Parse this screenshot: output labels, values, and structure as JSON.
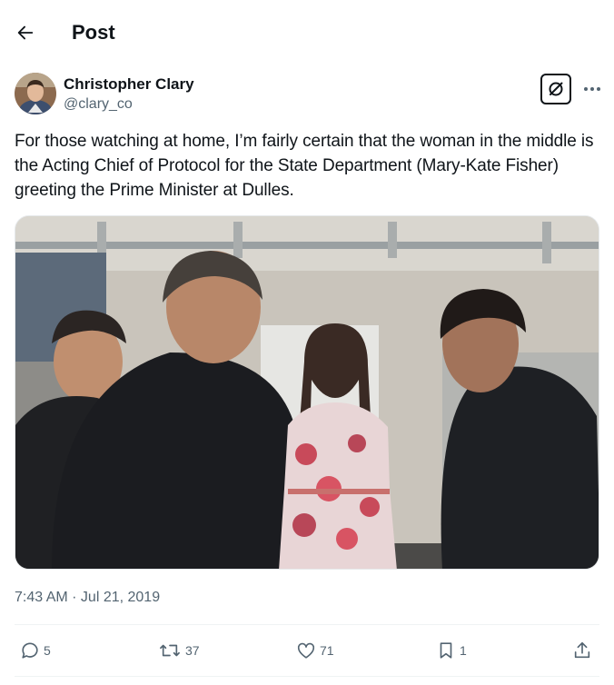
{
  "header": {
    "back_icon": "arrow-left-icon",
    "title": "Post"
  },
  "post": {
    "author_name": "Christopher Clary",
    "author_handle": "@clary_co",
    "grok_icon": "grok-icon",
    "more_icon": "more-horizontal-icon",
    "text": "For those watching at home, I’m fairly certain that the woman in the middle is the Acting Chief of Protocol for the State Department (Mary-Kate Fisher) greeting the Prime Minister at Dulles.",
    "timestamp": "7:43 AM · Jul 21, 2019"
  },
  "actions": {
    "replies": {
      "icon": "reply-icon",
      "count": "5"
    },
    "reposts": {
      "icon": "repost-icon",
      "count": "37"
    },
    "likes": {
      "icon": "heart-icon",
      "count": "71"
    },
    "bookmarks": {
      "icon": "bookmark-icon",
      "count": "1"
    },
    "share": {
      "icon": "share-icon"
    }
  },
  "colors": {
    "text_primary": "#0f1419",
    "text_secondary": "#536471",
    "divider": "#eff3f4"
  }
}
